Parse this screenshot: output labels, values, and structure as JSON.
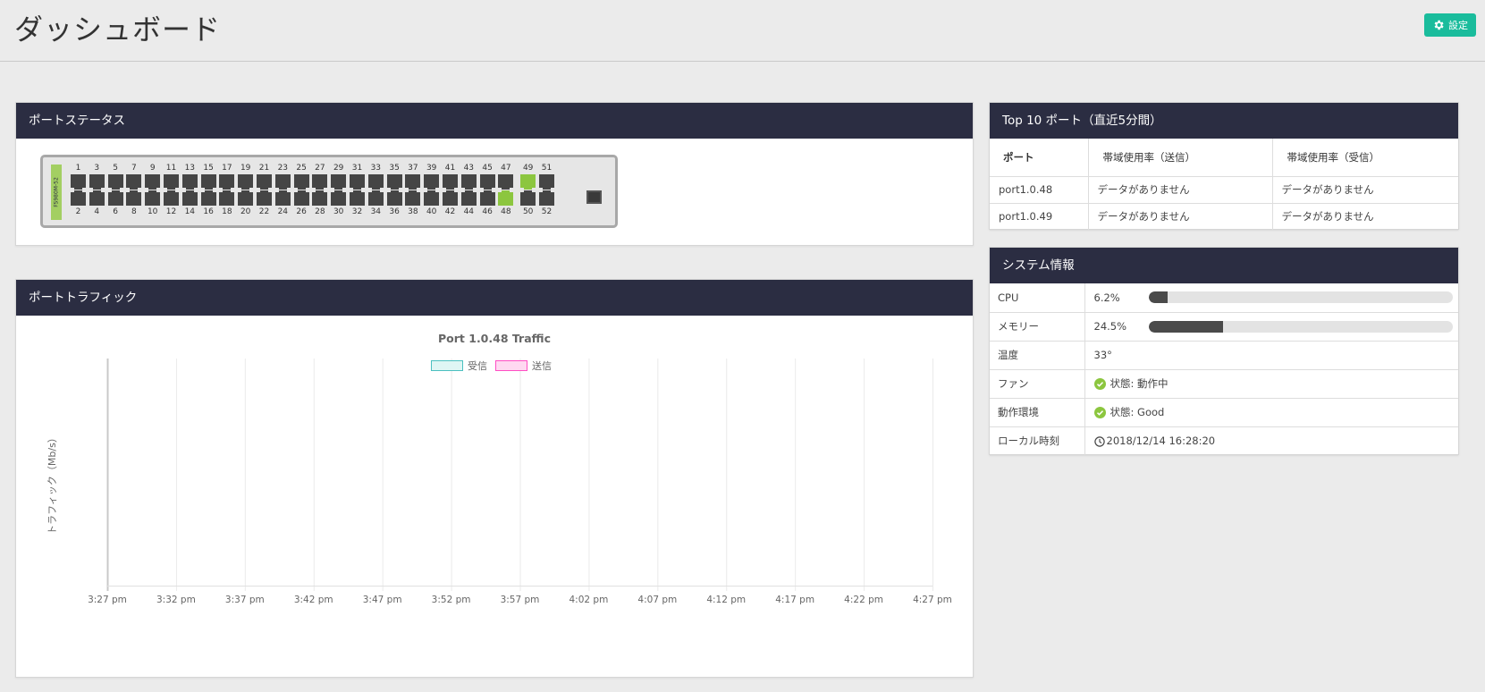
{
  "header": {
    "title": "ダッシュボード",
    "settings_label": "設定",
    "settings_icon": "gear-icon"
  },
  "ports_panel": {
    "title": "ポートステータス",
    "switch_label": "FS980M-52",
    "top_labels": [
      "1",
      "3",
      "5",
      "7",
      "9",
      "11",
      "13",
      "15",
      "17",
      "19",
      "21",
      "23",
      "25",
      "27",
      "29",
      "31",
      "33",
      "35",
      "37",
      "39",
      "41",
      "43",
      "45",
      "47",
      "49",
      "51"
    ],
    "bottom_labels": [
      "2",
      "4",
      "6",
      "8",
      "10",
      "12",
      "14",
      "16",
      "18",
      "20",
      "22",
      "24",
      "26",
      "28",
      "30",
      "32",
      "34",
      "36",
      "38",
      "40",
      "42",
      "44",
      "46",
      "48",
      "50",
      "52"
    ],
    "up_ports": [
      "48",
      "49"
    ]
  },
  "traffic_panel": {
    "title": "ポートトラフィック",
    "chart_data": {
      "type": "line",
      "title": "Port 1.0.48 Traffic",
      "ylabel": "トラフィック（Mb/s）",
      "xlabel": "",
      "x": [
        "3:27 pm",
        "3:32 pm",
        "3:37 pm",
        "3:42 pm",
        "3:47 pm",
        "3:52 pm",
        "3:57 pm",
        "4:02 pm",
        "4:07 pm",
        "4:12 pm",
        "4:17 pm",
        "4:22 pm",
        "4:27 pm"
      ],
      "series": [
        {
          "name": "受信",
          "values": [],
          "border": "#4bc0c0",
          "fill": "#dff6f4"
        },
        {
          "name": "送信",
          "values": [],
          "border": "#ff4fc4",
          "fill": "#ffd9f1"
        }
      ],
      "grid": true,
      "legend": "top"
    }
  },
  "top10_panel": {
    "title": "Top 10 ポート（直近5分間）",
    "columns": [
      "ポート",
      "帯域使用率（送信）",
      "帯域使用率（受信）"
    ],
    "rows": [
      [
        "port1.0.48",
        "データがありません",
        "データがありません"
      ],
      [
        "port1.0.49",
        "データがありません",
        "データがありません"
      ]
    ]
  },
  "system_panel": {
    "title": "システム情報",
    "cpu": {
      "label": "CPU",
      "text": "6.2%",
      "value": 6.2
    },
    "memory": {
      "label": "メモリー",
      "text": "24.5%",
      "value": 24.5
    },
    "temp": {
      "label": "温度",
      "value": "33°"
    },
    "fan": {
      "label": "ファン",
      "value": "状態: 動作中"
    },
    "env": {
      "label": "動作環境",
      "value": "状態: Good"
    },
    "time": {
      "label": "ローカル時刻",
      "value": "2018/12/14 16:28:20"
    },
    "colors": {
      "ok": "#8cc63f",
      "bar_fill": "#4a4a4a"
    }
  }
}
